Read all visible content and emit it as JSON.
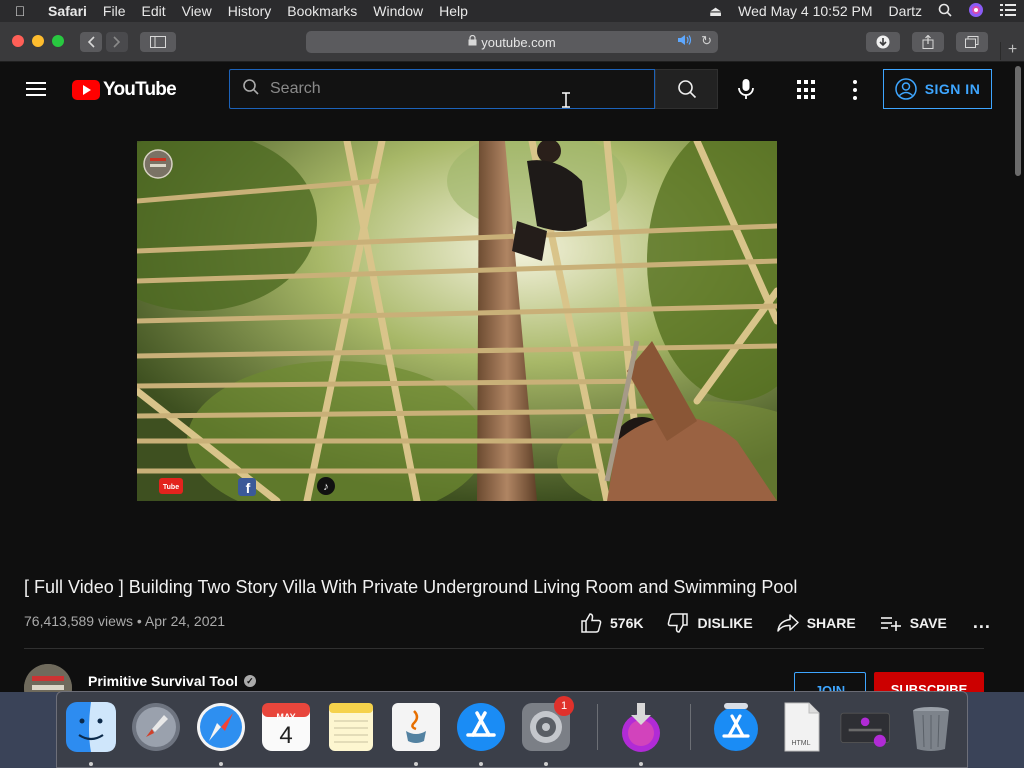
{
  "menubar": {
    "app_name": "Safari",
    "items": [
      "File",
      "Edit",
      "View",
      "History",
      "Bookmarks",
      "Window",
      "Help"
    ],
    "clock": "Wed May 4  10:52 PM",
    "user": "Dartz"
  },
  "browser": {
    "url": "youtube.com"
  },
  "youtube": {
    "logo_text": "YouTube",
    "search_placeholder": "Search",
    "sign_in_label": "SIGN IN",
    "video": {
      "title": "[ Full Video ] Building Two Story Villa With Private Underground Living Room and Swimming Pool",
      "views": "76,413,589 views",
      "separator": "•",
      "date": "Apr 24, 2021",
      "likes": "576K",
      "dislike_label": "DISLIKE",
      "share_label": "SHARE",
      "save_label": "SAVE",
      "more_label": "..."
    },
    "channel": {
      "name": "Primitive Survival Tool",
      "join_label": "JOIN",
      "subscribe_label": "SUBSCRIBE"
    }
  },
  "dock": {
    "calendar_month": "MAY",
    "calendar_day": "4",
    "sysprefs_badge": "1",
    "html_file_label": "HTML"
  },
  "colors": {
    "yt_red": "#ff0000",
    "yt_blue": "#3ea6ff",
    "page_bg": "#0f0f0f"
  }
}
